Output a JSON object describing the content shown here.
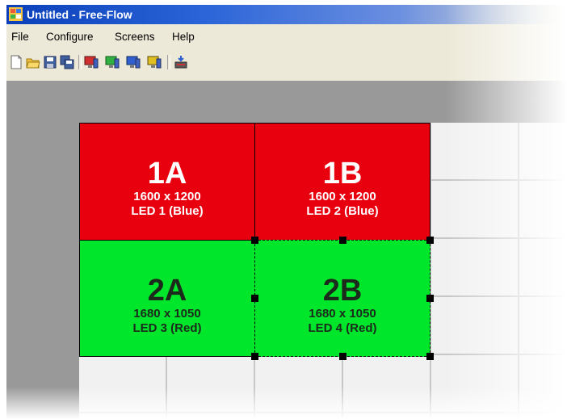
{
  "window": {
    "title": "Untitled - Free-Flow"
  },
  "menu": {
    "items": [
      "File",
      "Configure",
      "Screens",
      "Help"
    ]
  },
  "toolbar": {
    "buttons": [
      {
        "name": "new-file-icon"
      },
      {
        "name": "open-folder-icon"
      },
      {
        "name": "save-icon"
      },
      {
        "name": "save-all-icon"
      },
      {
        "name": "monitor-red-icon"
      },
      {
        "name": "monitor-green-icon"
      },
      {
        "name": "monitor-blue-icon"
      },
      {
        "name": "monitor-yellow-icon"
      },
      {
        "name": "apply-settings-icon"
      }
    ]
  },
  "screens": [
    {
      "id": "1A",
      "resolution": "1600 x 1200",
      "led": "LED 1 (Blue)",
      "color": "#e8000f",
      "selected": false
    },
    {
      "id": "1B",
      "resolution": "1600 x 1200",
      "led": "LED 2 (Blue)",
      "color": "#e8000f",
      "selected": false
    },
    {
      "id": "2A",
      "resolution": "1680 x 1050",
      "led": "LED 3 (Red)",
      "color": "#00e62a",
      "selected": false
    },
    {
      "id": "2B",
      "resolution": "1680 x 1050",
      "led": "LED 4 (Red)",
      "color": "#00e62a",
      "selected": true
    }
  ],
  "colors": {
    "titlebar": "#0a3fb9",
    "window_bg": "#ece9d8",
    "canvas_bg": "#999999",
    "grid_cell": "#f1f1f1",
    "screen_red": "#e8000f",
    "screen_green": "#00e62a"
  }
}
